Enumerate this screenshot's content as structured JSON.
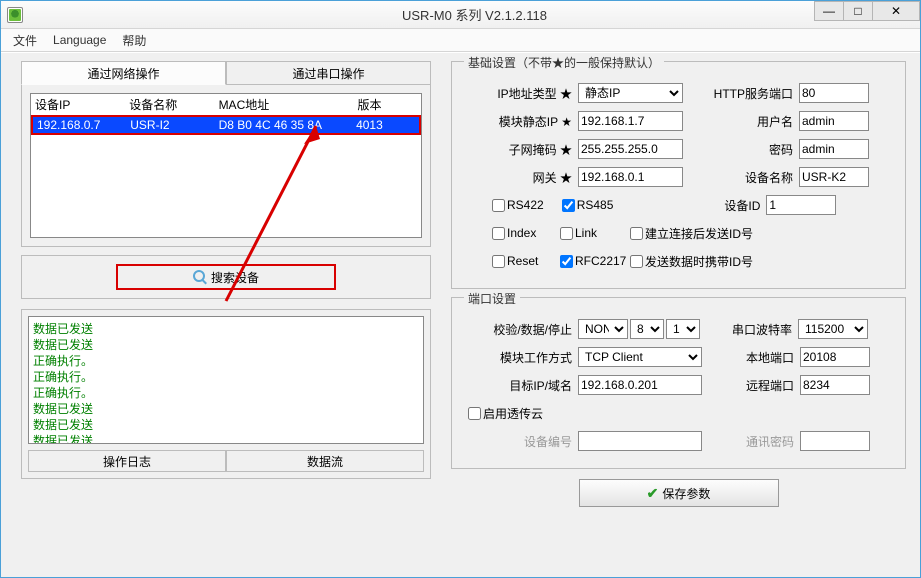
{
  "window": {
    "title": "USR-M0 系列 V2.1.2.118"
  },
  "menu": {
    "file": "文件",
    "language": "Language",
    "help": "帮助"
  },
  "tabs": {
    "net": "通过网络操作",
    "serial": "通过串口操作"
  },
  "devtable": {
    "headers": {
      "ip": "设备IP",
      "name": "设备名称",
      "mac": "MAC地址",
      "ver": "版本"
    },
    "row": {
      "ip": "192.168.0.7",
      "name": "USR-I2",
      "mac": "D8 B0 4C 46 35 8A",
      "ver": "4013"
    }
  },
  "search_btn": "搜索设备",
  "log": {
    "lines": [
      "数据已发送",
      "数据已发送",
      "正确执行。",
      "正确执行。",
      "正确执行。",
      "数据已发送",
      "数据已发送",
      "数据已发送"
    ],
    "tab_log": "操作日志",
    "tab_data": "数据流"
  },
  "basic": {
    "legend": "基础设置（不带★的一般保持默认）",
    "ip_type_label": "IP地址类型 ★",
    "ip_type_value": "静态IP",
    "static_ip_label": "模块静态IP ★",
    "static_ip_value": "192.168.1.7",
    "subnet_label": "子网掩码 ★",
    "subnet_value": "255.255.255.0",
    "gateway_label": "网关 ★",
    "gateway_value": "192.168.0.1",
    "http_port_label": "HTTP服务端口",
    "http_port_value": "80",
    "user_label": "用户名",
    "user_value": "admin",
    "pwd_label": "密码",
    "pwd_value": "admin",
    "devname_label": "设备名称",
    "devname_value": "USR-K2",
    "devid_label": "设备ID",
    "devid_value": "1",
    "rs422": "RS422",
    "rs485": "RS485",
    "index": "Index",
    "link": "Link",
    "send_id_on_conn": "建立连接后发送ID号",
    "reset": "Reset",
    "rfc2217": "RFC2217",
    "send_id_with_data": "发送数据时携带ID号"
  },
  "port": {
    "legend": "端口设置",
    "parity_label": "校验/数据/停止",
    "parity_value": "NONE",
    "data_bits": "8",
    "stop_bits": "1",
    "mode_label": "模块工作方式",
    "mode_value": "TCP Client",
    "target_label": "目标IP/域名",
    "target_value": "192.168.0.201",
    "baud_label": "串口波特率",
    "baud_value": "115200",
    "local_port_label": "本地端口",
    "local_port_value": "20108",
    "remote_port_label": "远程端口",
    "remote_port_value": "8234",
    "cloud_enable": "启用透传云",
    "cloud_devid_label": "设备编号",
    "cloud_pwd_label": "通讯密码"
  },
  "save_btn": "保存参数"
}
